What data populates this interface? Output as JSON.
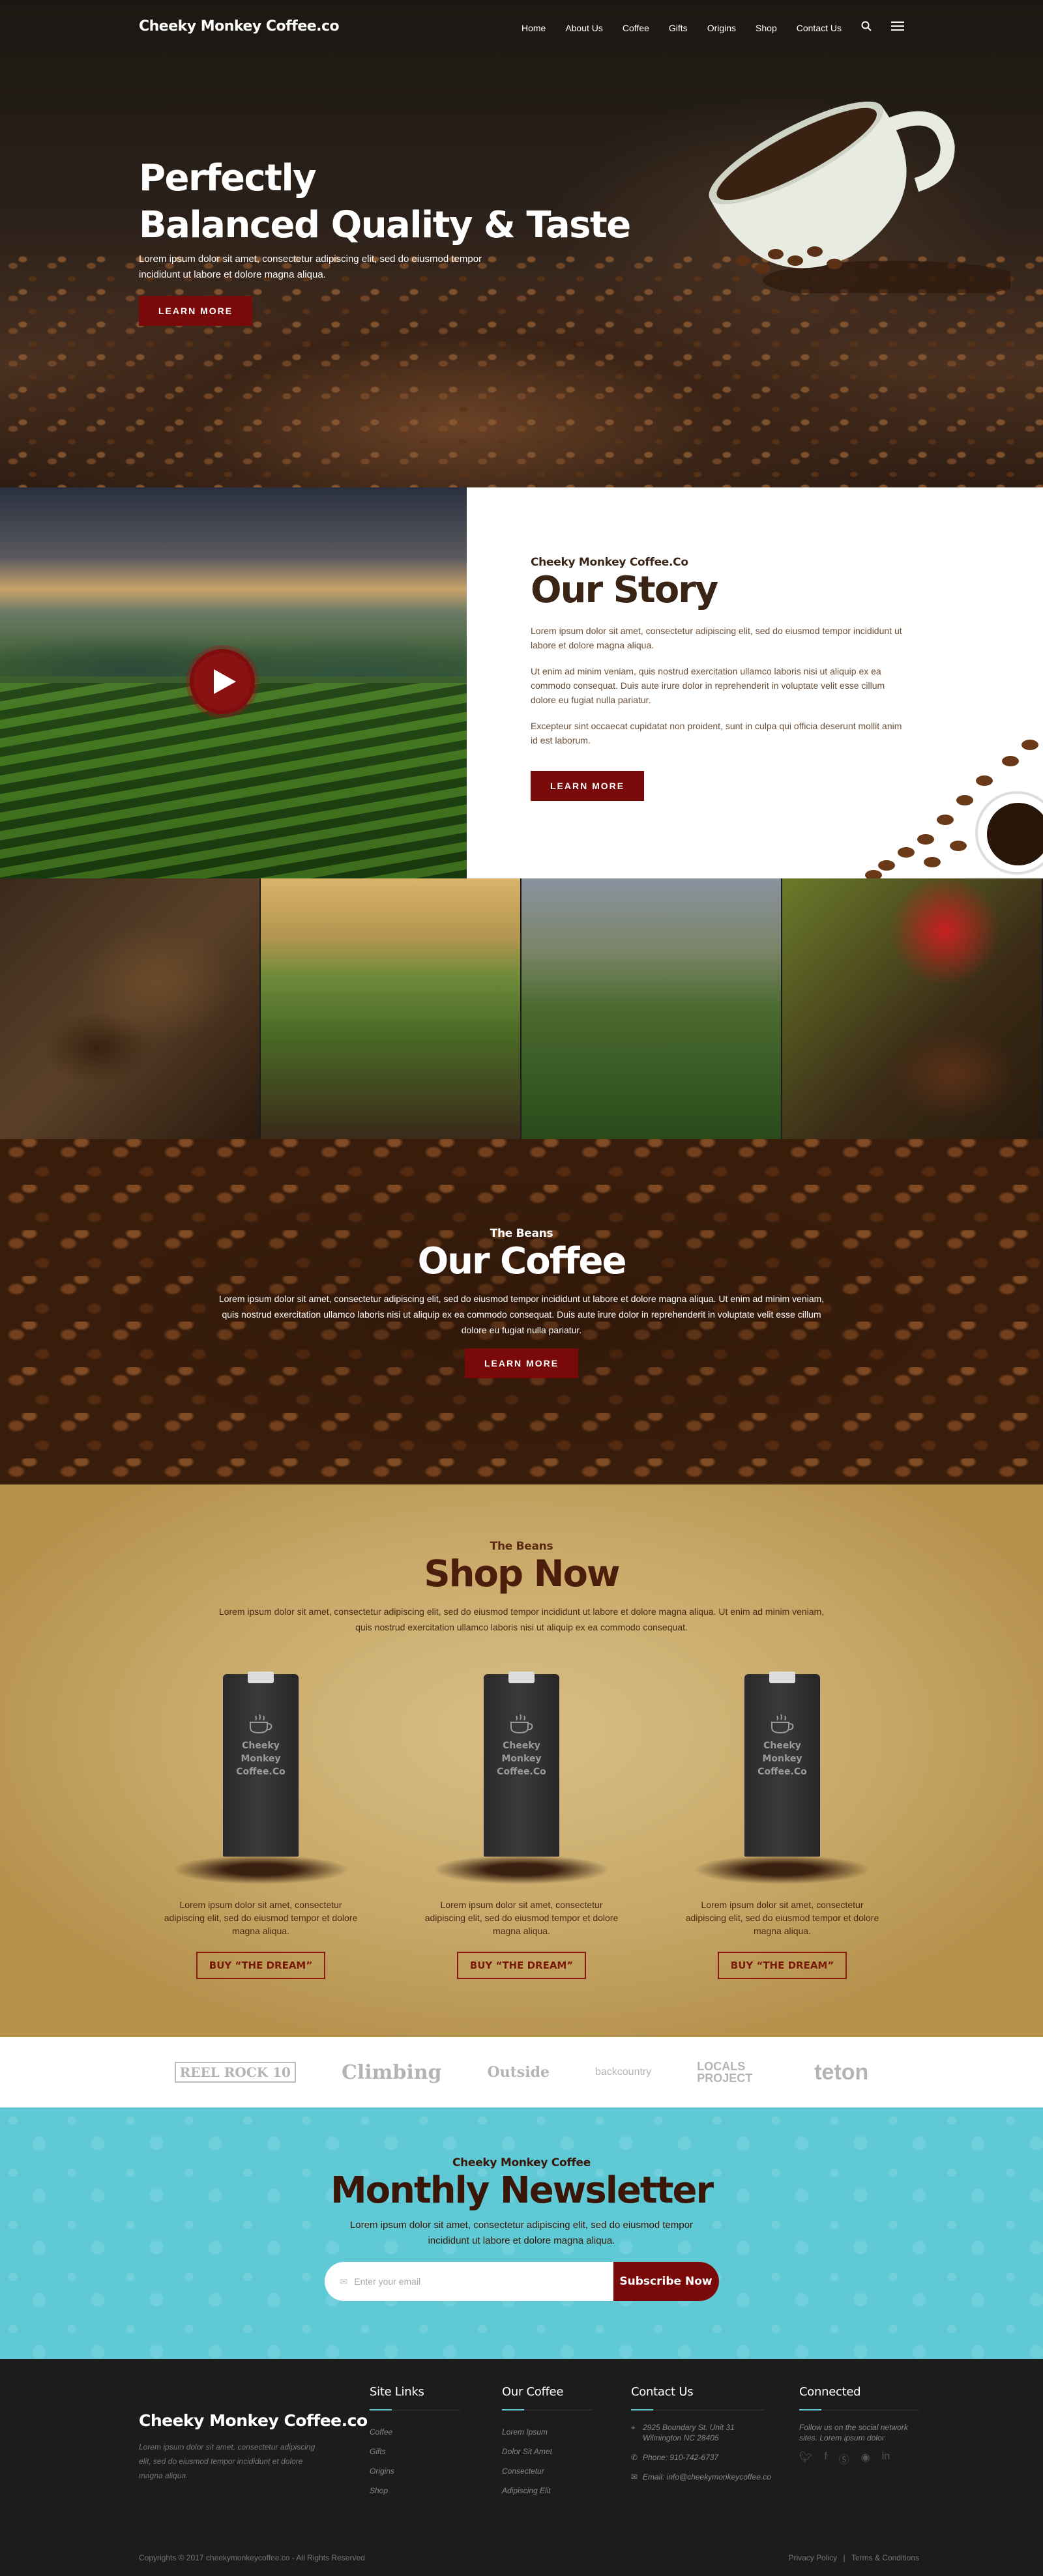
{
  "nav": {
    "brand": "Cheeky Monkey Coffee.co",
    "items": [
      "Home",
      "About Us",
      "Coffee",
      "Gifts",
      "Origins",
      "Shop",
      "Contact Us"
    ],
    "search_icon": "search-icon",
    "menu_icon": "hamburger-icon"
  },
  "hero": {
    "title_line1": "Perfectly",
    "title_line2": "Balanced Quality & Taste",
    "text": "Lorem ipsum dolor sit amet, consectetur adipiscing elit, sed do eiusmod tempor incididunt ut labore et dolore magna aliqua.",
    "button": "LEARN MORE"
  },
  "story": {
    "eyebrow": "Cheeky Monkey Coffee.Co",
    "title": "Our Story",
    "p1": "Lorem ipsum dolor sit amet, consectetur adipiscing elit, sed do eiusmod tempor incididunt ut labore et dolore magna aliqua.",
    "p2": "Ut enim ad minim veniam, quis nostrud exercitation ullamco laboris nisi ut aliquip ex ea commodo consequat. Duis aute irure dolor in reprehenderit in voluptate velit esse cillum dolore eu fugiat nulla pariatur.",
    "p3": "Excepteur sint occaecat cupidatat non proident, sunt in culpa qui officia deserunt mollit anim id est laborum.",
    "button": "LEARN MORE"
  },
  "coffee": {
    "eyebrow": "The Beans",
    "title": "Our Coffee",
    "text": "Lorem ipsum dolor sit amet, consectetur adipiscing elit, sed do eiusmod tempor incididunt ut labore et dolore magna aliqua. Ut enim ad minim veniam, quis nostrud exercitation ullamco laboris nisi ut aliquip ex ea commodo consequat. Duis aute irure dolor in reprehenderit in voluptate velit esse cillum dolore eu fugiat nulla pariatur.",
    "button": "LEARN MORE"
  },
  "shop": {
    "eyebrow": "The Beans",
    "title": "Shop Now",
    "text": "Lorem ipsum dolor sit amet, consectetur adipiscing elit, sed do eiusmod tempor incididunt ut labore et dolore magna aliqua. Ut enim ad minim veniam, quis nostrud exercitation ullamco laboris nisi ut aliquip ex ea commodo consequat.",
    "products": [
      {
        "bag_line1": "Cheeky Monkey",
        "bag_line2": "Coffee.Co",
        "text": "Lorem ipsum dolor sit amet, consectetur adipiscing elit, sed do eiusmod tempor et dolore magna aliqua.",
        "button": "BUY “THE DREAM”"
      },
      {
        "bag_line1": "Cheeky Monkey",
        "bag_line2": "Coffee.Co",
        "text": "Lorem ipsum dolor sit amet, consectetur adipiscing elit, sed do eiusmod tempor et dolore magna aliqua.",
        "button": "BUY “THE DREAM”"
      },
      {
        "bag_line1": "Cheeky Monkey",
        "bag_line2": "Coffee.Co",
        "text": "Lorem ipsum dolor sit amet, consectetur adipiscing elit, sed do eiusmod tempor et dolore magna aliqua.",
        "button": "BUY “THE DREAM”"
      }
    ]
  },
  "logos": [
    "REEL ROCK 10",
    "Climbing",
    "Outside",
    "backcountry",
    "LOCALS PROJECT",
    "teton"
  ],
  "newsletter": {
    "eyebrow": "Cheeky Monkey Coffee",
    "title": "Monthly Newsletter",
    "text": "Lorem ipsum dolor sit amet, consectetur adipiscing elit, sed do eiusmod tempor incididunt ut labore et dolore magna aliqua.",
    "placeholder": "Enter your email",
    "button": "Subscribe Now"
  },
  "footer": {
    "brand": "Cheeky Monkey Coffee.co",
    "about": "Lorem ipsum dolor sit amet, consectetur adipiscing elit, sed do eiusmod tempor incididunt et dolore magna aliqua.",
    "site_links": {
      "title": "Site Links",
      "items": [
        "Coffee",
        "Gifts",
        "Origins",
        "Shop"
      ]
    },
    "our_coffee": {
      "title": "Our Coffee",
      "items": [
        "Lorem Ipsum",
        "Dolor Sit Amet",
        "Consectetur",
        "Adipiscing Elit"
      ]
    },
    "contact": {
      "title": "Contact Us",
      "address": "2925 Boundary St. Unit 31 Wilmington NC 28405",
      "phone": "Phone: 910-742-6737",
      "email": "Email: info@cheekymonkeycoffee.co"
    },
    "connected": {
      "title": "Connected",
      "text": "Follow us on the social network sites. Lorem ipsum dolor",
      "icons": [
        "twitter-icon",
        "facebook-icon",
        "skype-icon",
        "rss-icon",
        "linkedin-icon"
      ]
    },
    "copyright": "Copyrights © 2017 cheekymonkeycoffee.co - All Rights Reserved",
    "privacy": "Privacy Policy",
    "separator": "|",
    "terms": "Terms & Conditions"
  }
}
